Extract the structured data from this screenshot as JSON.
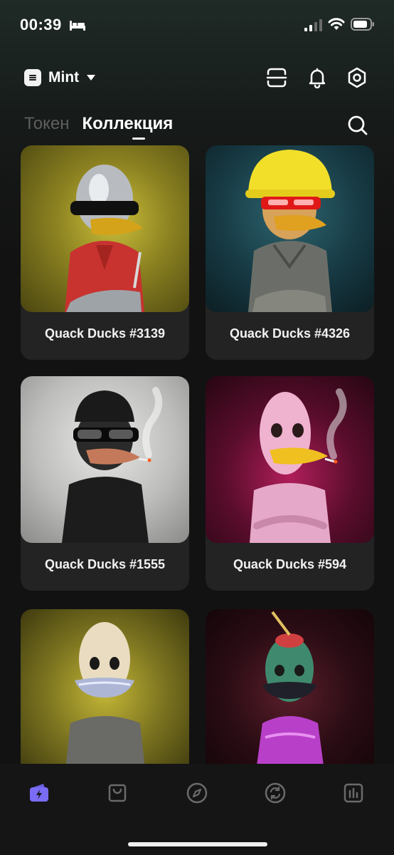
{
  "status_bar": {
    "time": "00:39",
    "icons": [
      "bed-icon",
      "cellular-signal-icon",
      "wifi-icon",
      "battery-icon"
    ]
  },
  "header": {
    "wallet_name": "Mint",
    "icons": [
      "wallet-logo-icon",
      "chevron-down-icon",
      "scan-icon",
      "bell-icon",
      "settings-icon"
    ]
  },
  "tabs": [
    {
      "label": "Токен",
      "active": false
    },
    {
      "label": "Коллекция",
      "active": true
    }
  ],
  "collection": {
    "items": [
      {
        "title": "Quack Ducks #3139",
        "image": "chrome-duck-red-shirt-sunglasses"
      },
      {
        "title": "Quack Ducks #4326",
        "image": "duck-yellow-hard-hat-red-visor"
      },
      {
        "title": "Quack Ducks #1555",
        "image": "black-duck-beanie-sunglasses-cigarette"
      },
      {
        "title": "Quack Ducks #594",
        "image": "pink-duck-cigarette"
      },
      {
        "title": "",
        "image": "pale-duck-chrome-beak"
      },
      {
        "title": "",
        "image": "green-duck-plunger-hat"
      }
    ]
  },
  "bottom_nav": {
    "items": [
      {
        "icon": "wallet-icon",
        "active": true
      },
      {
        "icon": "shopping-bag-icon",
        "active": false
      },
      {
        "icon": "compass-icon",
        "active": false
      },
      {
        "icon": "swap-icon",
        "active": false
      },
      {
        "icon": "chart-icon",
        "active": false
      }
    ]
  },
  "colors": {
    "accent": "#7b6cf6",
    "background": "#121212",
    "card": "#232323",
    "inactive_tab": "#5e5e5e"
  }
}
